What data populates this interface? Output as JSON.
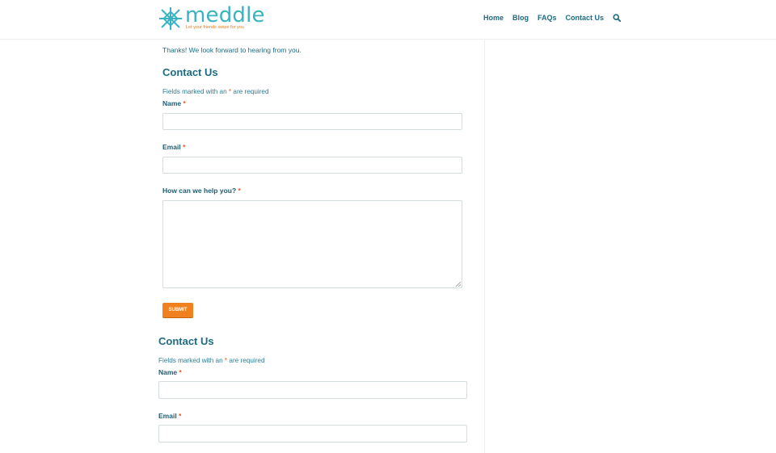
{
  "header": {
    "logo_text": "meddle",
    "logo_tagline": "Let your friends swipe for you",
    "nav": [
      "Home",
      "Blog",
      "FAQs",
      "Contact Us"
    ]
  },
  "main": {
    "thanks_message": "Thanks! We look forward to hearing from you.",
    "form1": {
      "title": "Contact Us",
      "required_note_prefix": "Fields marked with an ",
      "required_star": "*",
      "required_note_suffix": " are required",
      "name_label": "Name",
      "email_label": "Email",
      "message_label": "How can we help you?",
      "submit_label": "SUBMIT"
    },
    "form2": {
      "title": "Contact Us",
      "required_note_prefix": "Fields marked with an ",
      "required_star": "*",
      "required_note_suffix": " are required",
      "name_label": "Name",
      "email_label": "Email"
    }
  },
  "colors": {
    "brand_teal": "#39b3c2",
    "text_teal": "#1d6c83",
    "accent_orange": "#f0811e",
    "required_red": "#e35a1a"
  },
  "icons": [
    "logo-knot-icon",
    "search-icon",
    "resize-grip-icon"
  ]
}
